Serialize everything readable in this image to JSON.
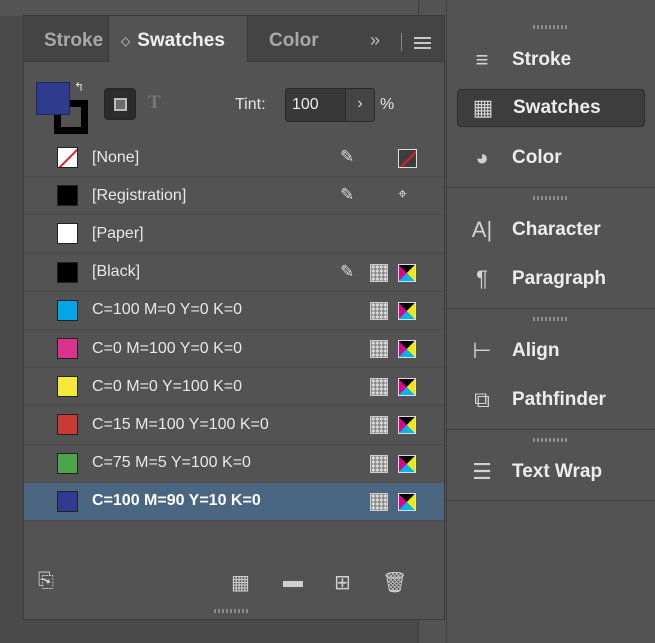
{
  "tabs": [
    {
      "label": "Stroke"
    },
    {
      "label": "Swatches"
    },
    {
      "label": "Color"
    }
  ],
  "tab_overflow": "»",
  "header": {
    "fill_color": "#2e3b8f",
    "stroke_color": "#000000",
    "text_format_glyph": "T",
    "tint_label": "Tint:",
    "tint_value": "100",
    "tint_stepper": "›",
    "tint_unit": "%"
  },
  "swatches": [
    {
      "name": "[None]",
      "color": "none",
      "icons": [
        "edit-locked",
        "none"
      ]
    },
    {
      "name": "[Registration]",
      "color": "#000000",
      "icons": [
        "edit-locked",
        "registration"
      ]
    },
    {
      "name": "[Paper]",
      "color": "#ffffff",
      "icons": []
    },
    {
      "name": "[Black]",
      "color": "#000000",
      "icons": [
        "edit-locked",
        "process",
        "cmyk"
      ]
    },
    {
      "name": "C=100 M=0 Y=0 K=0",
      "color": "#00a6e6",
      "icons": [
        "process",
        "cmyk"
      ]
    },
    {
      "name": "C=0 M=100 Y=0 K=0",
      "color": "#d9338c",
      "icons": [
        "process",
        "cmyk"
      ]
    },
    {
      "name": "C=0 M=0 Y=100 K=0",
      "color": "#f5e93a",
      "icons": [
        "process",
        "cmyk"
      ]
    },
    {
      "name": "C=15 M=100 Y=100 K=0",
      "color": "#c83a33",
      "icons": [
        "process",
        "cmyk"
      ]
    },
    {
      "name": "C=75 M=5 Y=100 K=0",
      "color": "#4ea44a",
      "icons": [
        "process",
        "cmyk"
      ]
    },
    {
      "name": "C=100 M=90 Y=10 K=0",
      "color": "#2e3b8f",
      "icons": [
        "process",
        "cmyk"
      ],
      "selected": true
    }
  ],
  "dock": {
    "items": [
      {
        "label": "Stroke",
        "icon": "stroke-lines-icon"
      },
      {
        "label": "Swatches",
        "icon": "swatches-grid-icon",
        "active": true
      },
      {
        "label": "Color",
        "icon": "palette-icon"
      },
      {
        "label": "Character",
        "icon": "character-icon"
      },
      {
        "label": "Paragraph",
        "icon": "pilcrow-icon"
      },
      {
        "label": "Align",
        "icon": "align-icon"
      },
      {
        "label": "Pathfinder",
        "icon": "pathfinder-icon"
      },
      {
        "label": "Text Wrap",
        "icon": "text-wrap-icon"
      }
    ]
  }
}
